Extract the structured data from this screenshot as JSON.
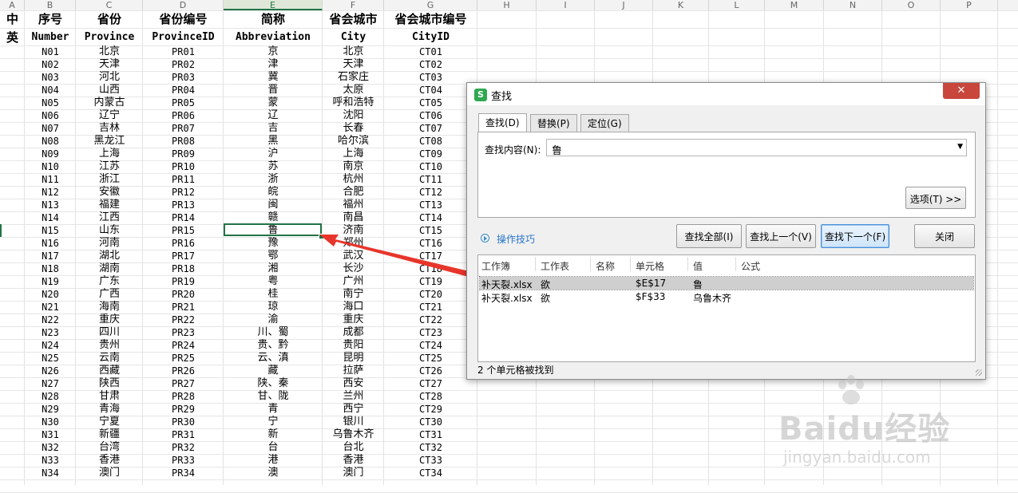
{
  "sheet": {
    "column_letters": [
      "A",
      "B",
      "C",
      "D",
      "E",
      "F",
      "G",
      "H",
      "I",
      "J",
      "K",
      "L",
      "M",
      "N",
      "O",
      "P"
    ],
    "active_column": "E",
    "header_cn": [
      "中",
      "序号",
      "省份",
      "省份编号",
      "简称",
      "省会城市",
      "省会城市编号"
    ],
    "header_en": [
      "英",
      "Number",
      "Province",
      "ProvinceID",
      "Abbreviation",
      "City",
      "CityID"
    ],
    "rows": [
      [
        "N01",
        "北京",
        "PR01",
        "京",
        "北京",
        "CT01"
      ],
      [
        "N02",
        "天津",
        "PR02",
        "津",
        "天津",
        "CT02"
      ],
      [
        "N03",
        "河北",
        "PR03",
        "冀",
        "石家庄",
        "CT03"
      ],
      [
        "N04",
        "山西",
        "PR04",
        "晋",
        "太原",
        "CT04"
      ],
      [
        "N05",
        "内蒙古",
        "PR05",
        "蒙",
        "呼和浩特",
        "CT05"
      ],
      [
        "N06",
        "辽宁",
        "PR06",
        "辽",
        "沈阳",
        "CT06"
      ],
      [
        "N07",
        "吉林",
        "PR07",
        "吉",
        "长春",
        "CT07"
      ],
      [
        "N08",
        "黑龙江",
        "PR08",
        "黑",
        "哈尔滨",
        "CT08"
      ],
      [
        "N09",
        "上海",
        "PR09",
        "沪",
        "上海",
        "CT09"
      ],
      [
        "N10",
        "江苏",
        "PR10",
        "苏",
        "南京",
        "CT10"
      ],
      [
        "N11",
        "浙江",
        "PR11",
        "浙",
        "杭州",
        "CT11"
      ],
      [
        "N12",
        "安徽",
        "PR12",
        "皖",
        "合肥",
        "CT12"
      ],
      [
        "N13",
        "福建",
        "PR13",
        "闽",
        "福州",
        "CT13"
      ],
      [
        "N14",
        "江西",
        "PR14",
        "赣",
        "南昌",
        "CT14"
      ],
      [
        "N15",
        "山东",
        "PR15",
        "鲁",
        "济南",
        "CT15"
      ],
      [
        "N16",
        "河南",
        "PR16",
        "豫",
        "郑州",
        "CT16"
      ],
      [
        "N17",
        "湖北",
        "PR17",
        "鄂",
        "武汉",
        "CT17"
      ],
      [
        "N18",
        "湖南",
        "PR18",
        "湘",
        "长沙",
        "CT18"
      ],
      [
        "N19",
        "广东",
        "PR19",
        "粤",
        "广州",
        "CT19"
      ],
      [
        "N20",
        "广西",
        "PR20",
        "桂",
        "南宁",
        "CT20"
      ],
      [
        "N21",
        "海南",
        "PR21",
        "琼",
        "海口",
        "CT21"
      ],
      [
        "N22",
        "重庆",
        "PR22",
        "渝",
        "重庆",
        "CT22"
      ],
      [
        "N23",
        "四川",
        "PR23",
        "川、蜀",
        "成都",
        "CT23"
      ],
      [
        "N24",
        "贵州",
        "PR24",
        "贵、黔",
        "贵阳",
        "CT24"
      ],
      [
        "N25",
        "云南",
        "PR25",
        "云、滇",
        "昆明",
        "CT25"
      ],
      [
        "N26",
        "西藏",
        "PR26",
        "藏",
        "拉萨",
        "CT26"
      ],
      [
        "N27",
        "陕西",
        "PR27",
        "陕、秦",
        "西安",
        "CT27"
      ],
      [
        "N28",
        "甘肃",
        "PR28",
        "甘、陇",
        "兰州",
        "CT28"
      ],
      [
        "N29",
        "青海",
        "PR29",
        "青",
        "西宁",
        "CT29"
      ],
      [
        "N30",
        "宁夏",
        "PR30",
        "宁",
        "银川",
        "CT30"
      ],
      [
        "N31",
        "新疆",
        "PR31",
        "新",
        "乌鲁木齐",
        "CT31"
      ],
      [
        "N32",
        "台湾",
        "PR32",
        "台",
        "台北",
        "CT32"
      ],
      [
        "N33",
        "香港",
        "PR33",
        "港",
        "香港",
        "CT33"
      ],
      [
        "N34",
        "澳门",
        "PR34",
        "澳",
        "澳门",
        "CT34"
      ]
    ],
    "selected_row_index": 14
  },
  "dialog": {
    "title": "查找",
    "logo_glyph": "S",
    "close_glyph": "✕",
    "tabs": [
      "查找(D)",
      "替换(P)",
      "定位(G)"
    ],
    "find_label": "查找内容(N):",
    "find_value": "鲁",
    "dropdown_glyph": "▼",
    "options_button": "选项(T) >>",
    "tips_link": "操作技巧",
    "buttons": {
      "find_all": "查找全部(I)",
      "find_prev": "查找上一个(V)",
      "find_next": "查找下一个(F)",
      "close": "关闭"
    },
    "result_columns": [
      "工作簿",
      "工作表",
      "名称",
      "单元格",
      "值",
      "公式"
    ],
    "results": [
      {
        "workbook": "补天裂.xlsx",
        "sheet": "欲",
        "name": "",
        "cell": "$E$17",
        "value": "鲁",
        "formula": ""
      },
      {
        "workbook": "补天裂.xlsx",
        "sheet": "欲",
        "name": "",
        "cell": "$F$33",
        "value": "乌鲁木齐",
        "formula": ""
      }
    ],
    "status": "2 个单元格被找到"
  },
  "annotation_color": "#e8352b",
  "watermark": {
    "logo": "Baidu经验",
    "url": "jingyan.baidu.com"
  }
}
